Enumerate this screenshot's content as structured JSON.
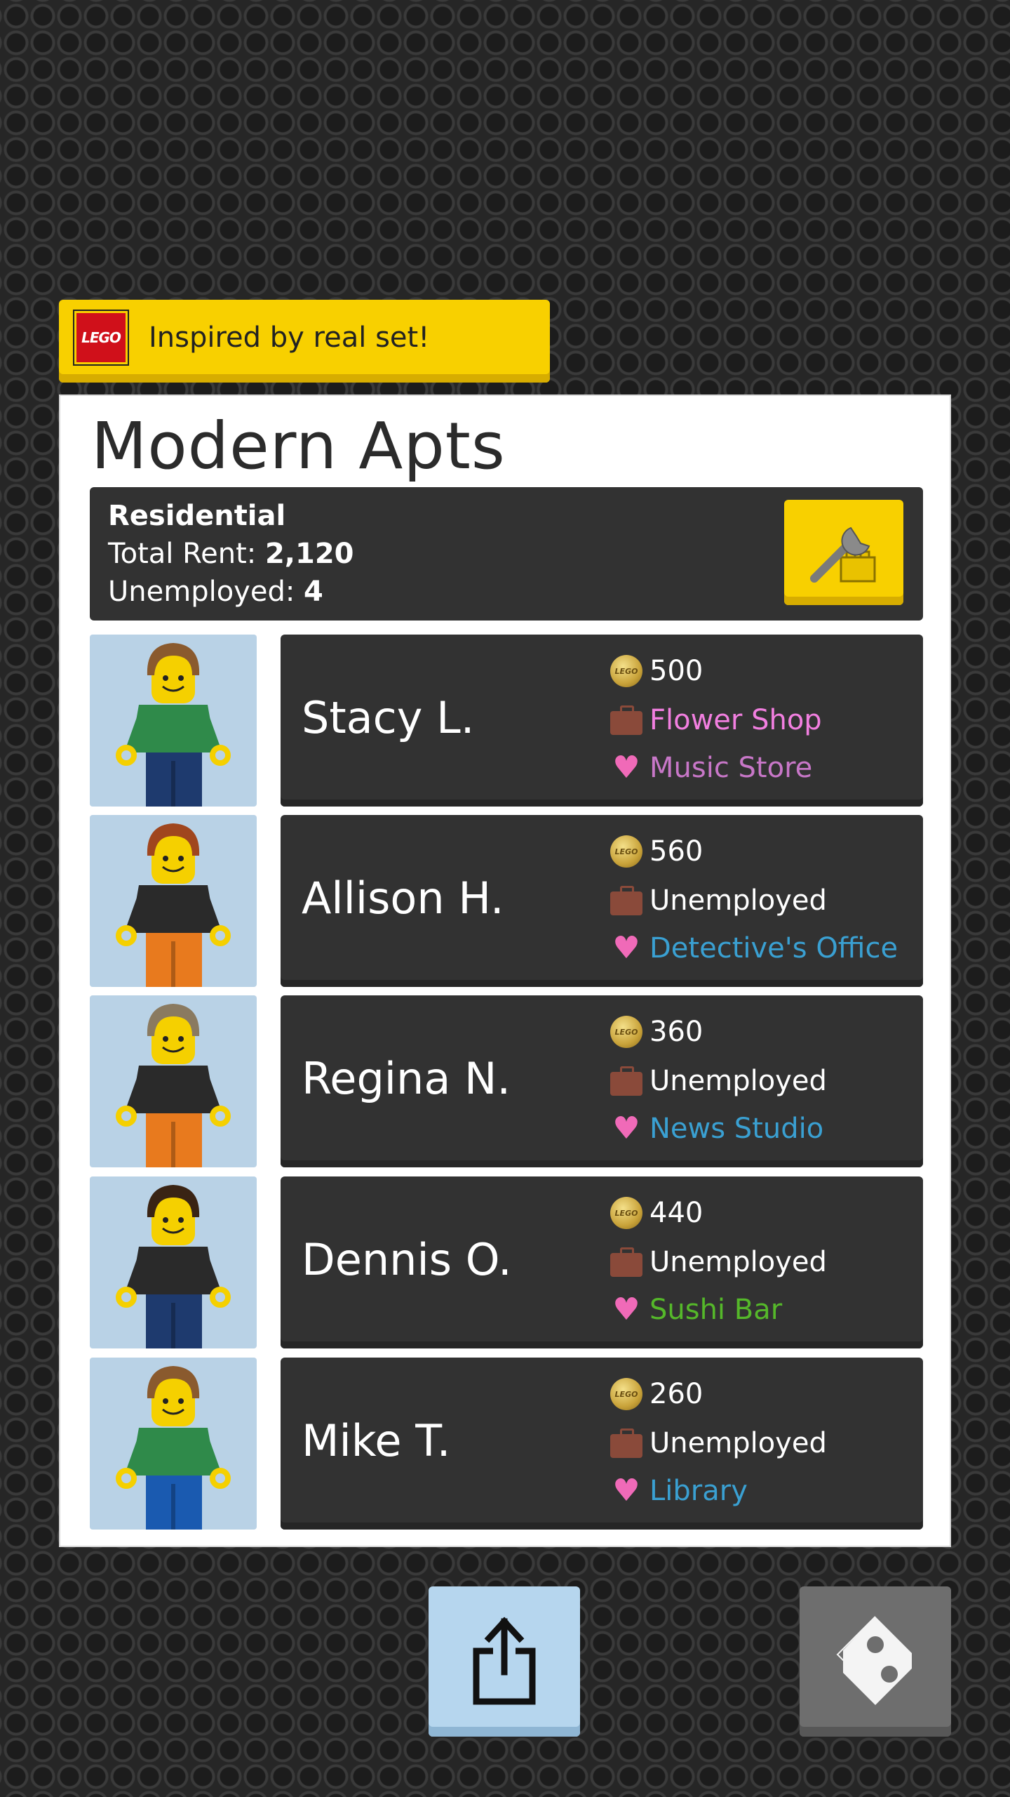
{
  "banner": {
    "logo_text": "LEGO",
    "text": "Inspired by real set!"
  },
  "building": {
    "title": "Modern Apts",
    "type": "Residential",
    "rent_label": "Total Rent: ",
    "rent_value": "2,120",
    "unemployed_label": "Unemployed: ",
    "unemployed_value": "4"
  },
  "residents": [
    {
      "name": "Stacy L.",
      "coins": "500",
      "job": "Flower Shop",
      "likes": "Music Store",
      "hair": "#8a5a2e",
      "torso": "#2f8a4a",
      "legs": "#1e3a6e",
      "job_class": "job-pink",
      "likes_class": "like-purple"
    },
    {
      "name": "Allison H.",
      "coins": "560",
      "job": "Unemployed",
      "likes": "Detective's Office",
      "hair": "#a0461e",
      "torso": "#2a2a2a",
      "legs": "#e87a1e",
      "job_class": "",
      "likes_class": "like-blue"
    },
    {
      "name": "Regina N.",
      "coins": "360",
      "job": "Unemployed",
      "likes": "News Studio",
      "hair": "#8a7a60",
      "torso": "#2a2a2a",
      "legs": "#e87a1e",
      "job_class": "",
      "likes_class": "like-blue"
    },
    {
      "name": "Dennis O.",
      "coins": "440",
      "job": "Unemployed",
      "likes": "Sushi Bar",
      "hair": "#3a2414",
      "torso": "#2a2a2a",
      "legs": "#1e3a6e",
      "job_class": "",
      "likes_class": "like-green"
    },
    {
      "name": "Mike T.",
      "coins": "260",
      "job": "Unemployed",
      "likes": "Library",
      "hair": "#8a5a2e",
      "torso": "#2f8a4a",
      "legs": "#1a5ab0",
      "job_class": "",
      "likes_class": "like-blue"
    }
  ],
  "icons": {
    "coin": "lego-coin-icon",
    "job": "briefcase-icon",
    "likes": "heart-icon",
    "share": "share-icon",
    "back": "back-brick-icon",
    "edit": "wrench-brick-icon"
  }
}
